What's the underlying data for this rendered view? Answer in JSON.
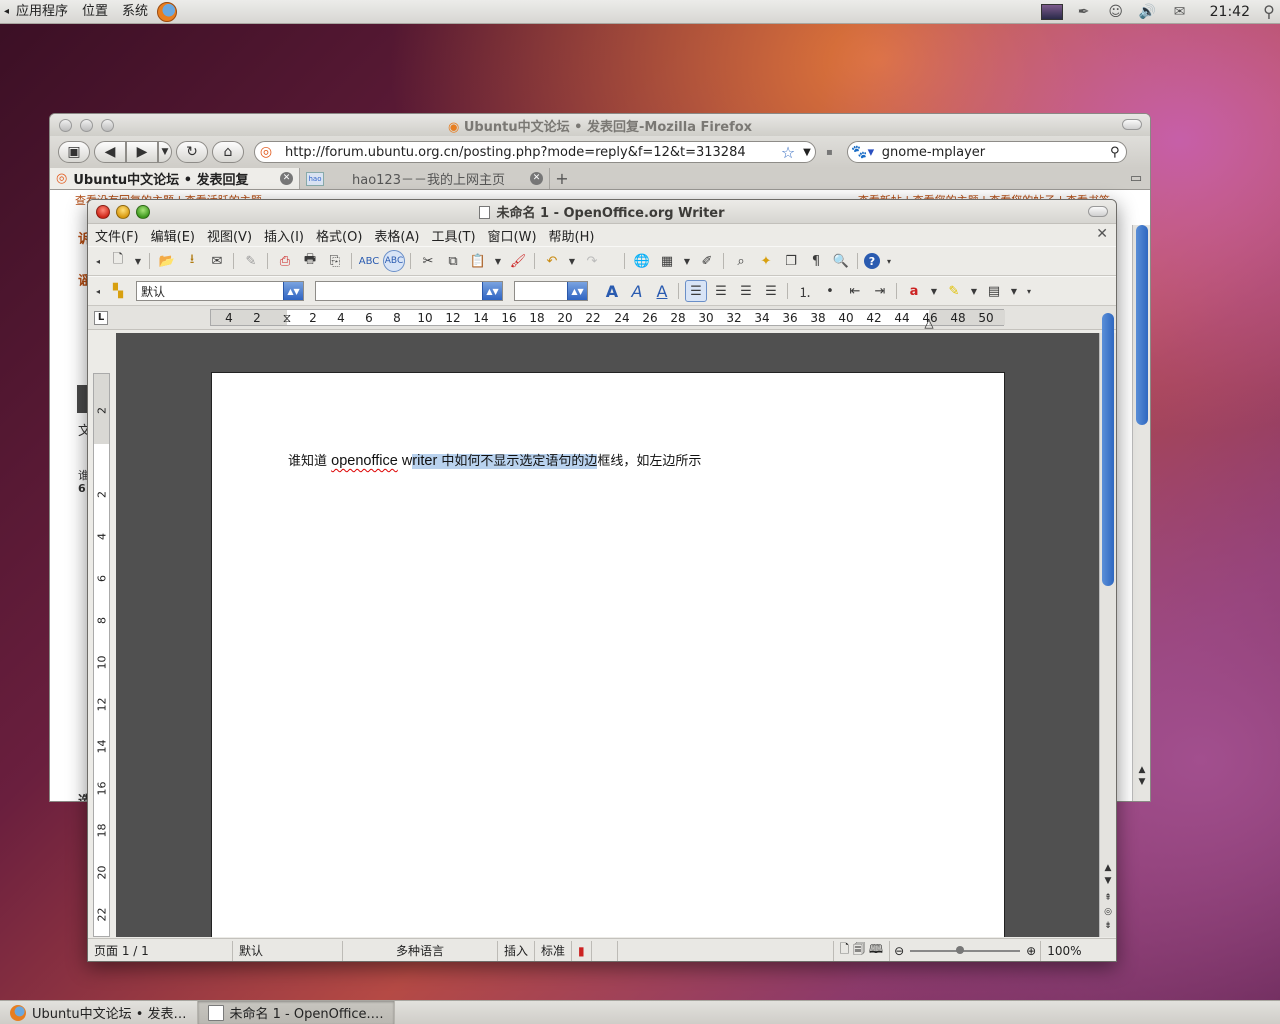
{
  "top_panel": {
    "menus": [
      "应用程序",
      "位置",
      "系统"
    ],
    "clock": "21:42",
    "tray_icons": [
      "network-icon",
      "pen-icon",
      "people-icon",
      "volume-icon",
      "mail-icon"
    ]
  },
  "firefox": {
    "title": "Ubuntu中文论坛 • 发表回复-Mozilla Firefox",
    "url": "http://forum.ubuntu.org.cn/posting.php?mode=reply&f=12&t=313284",
    "search_value": "gnome-mplayer",
    "tabs": [
      {
        "label": "Ubuntu中文论坛 • 发表回复",
        "active": true
      },
      {
        "label": "hao123－－我的上网主页",
        "active": false
      }
    ],
    "page_links_left": "查看没有回复的主题 | 查看活跃的主题",
    "page_links_right": "查看新帖 | 查看您的主题 | 查看您的帖子 | 查看书签",
    "left_fragments": [
      "诉",
      "谣",
      "文",
      "谁",
      "6",
      "选"
    ]
  },
  "writer": {
    "title": "未命名 1 - OpenOffice.org Writer",
    "menus": [
      "文件(F)",
      "编辑(E)",
      "视图(V)",
      "插入(I)",
      "格式(O)",
      "表格(A)",
      "工具(T)",
      "窗口(W)",
      "帮助(H)"
    ],
    "style_value": "默认",
    "font_value": "",
    "size_value": "",
    "ruler_labels": [
      "4",
      "2",
      "2",
      "4",
      "6",
      "8",
      "10",
      "12",
      "14",
      "16",
      "18",
      "20",
      "22",
      "24",
      "26",
      "28",
      "30",
      "32",
      "34",
      "36",
      "38",
      "40",
      "42",
      "44",
      "46",
      "48",
      "50"
    ],
    "vruler_labels": [
      "2",
      "2",
      "4",
      "6",
      "8",
      "10",
      "12",
      "14",
      "16",
      "18",
      "20",
      "22"
    ],
    "doc": {
      "pre": "谁知道 ",
      "word1": "openoffice",
      "mid1": " w",
      "sel_en": "riter",
      "sel_cn": " 中如何不显示选定语句的边",
      "post": "框线，如左边所示"
    },
    "status": {
      "page": "页面 1 / 1",
      "style": "默认",
      "language": "多种语言",
      "insert": "插入",
      "select_mode": "标准",
      "zoom": "100%"
    }
  },
  "taskbar": {
    "items": [
      {
        "label": "Ubuntu中文论坛 • 发表…",
        "active": false
      },
      {
        "label": "未命名 1 - OpenOffice.…",
        "active": true
      }
    ]
  }
}
